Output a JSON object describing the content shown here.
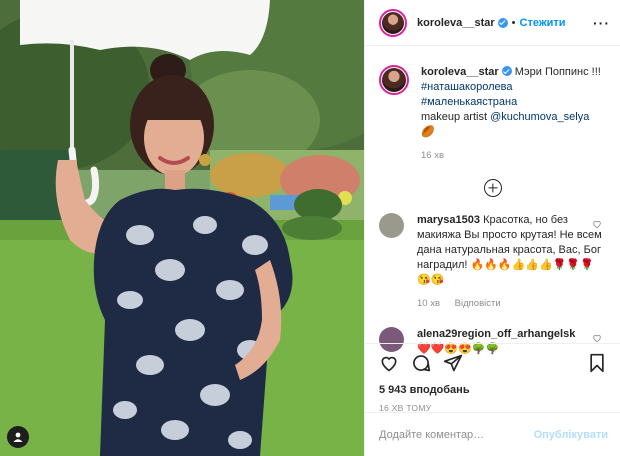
{
  "header": {
    "username": "koroleva__star",
    "separator": "•",
    "follow_label": "Стежити",
    "more": "···"
  },
  "caption": {
    "username": "koroleva__star",
    "text": "Мэри Поппинс !!!",
    "hashtags": "#наташакоролева #маленькаястрана",
    "credit_prefix": "makeup artist",
    "credit_handle": "@kuchumova_selya",
    "credit_emoji": "🏉",
    "time": "16 хв"
  },
  "comments": [
    {
      "username": "marysa1503",
      "text": "Красотка, но без макияжа Вы просто крутая! Не всем дана натуральная красота, Вас, Бог наградил! 🔥🔥🔥👍👍👍🌹🌹🌹😘😘",
      "time": "10 хв",
      "reply": "Відповісти",
      "avatar_color": "#9a9a8c"
    },
    {
      "username": "alena29region_off_arhangelsk",
      "text": "❤️❤️😍😍🌳🌳",
      "avatar_color": "#7a5a78"
    }
  ],
  "post": {
    "likes": "5 943 вподобань",
    "posted": "16 ХВ ТОМУ"
  },
  "add_comment": {
    "placeholder": "Додайте коментар…",
    "publish": "Опублікувати"
  },
  "icons": [
    "heart-icon",
    "comment-icon",
    "share-icon",
    "bookmark-icon",
    "plus-circle-icon",
    "user-tag-icon",
    "verified-icon",
    "more-icon"
  ]
}
